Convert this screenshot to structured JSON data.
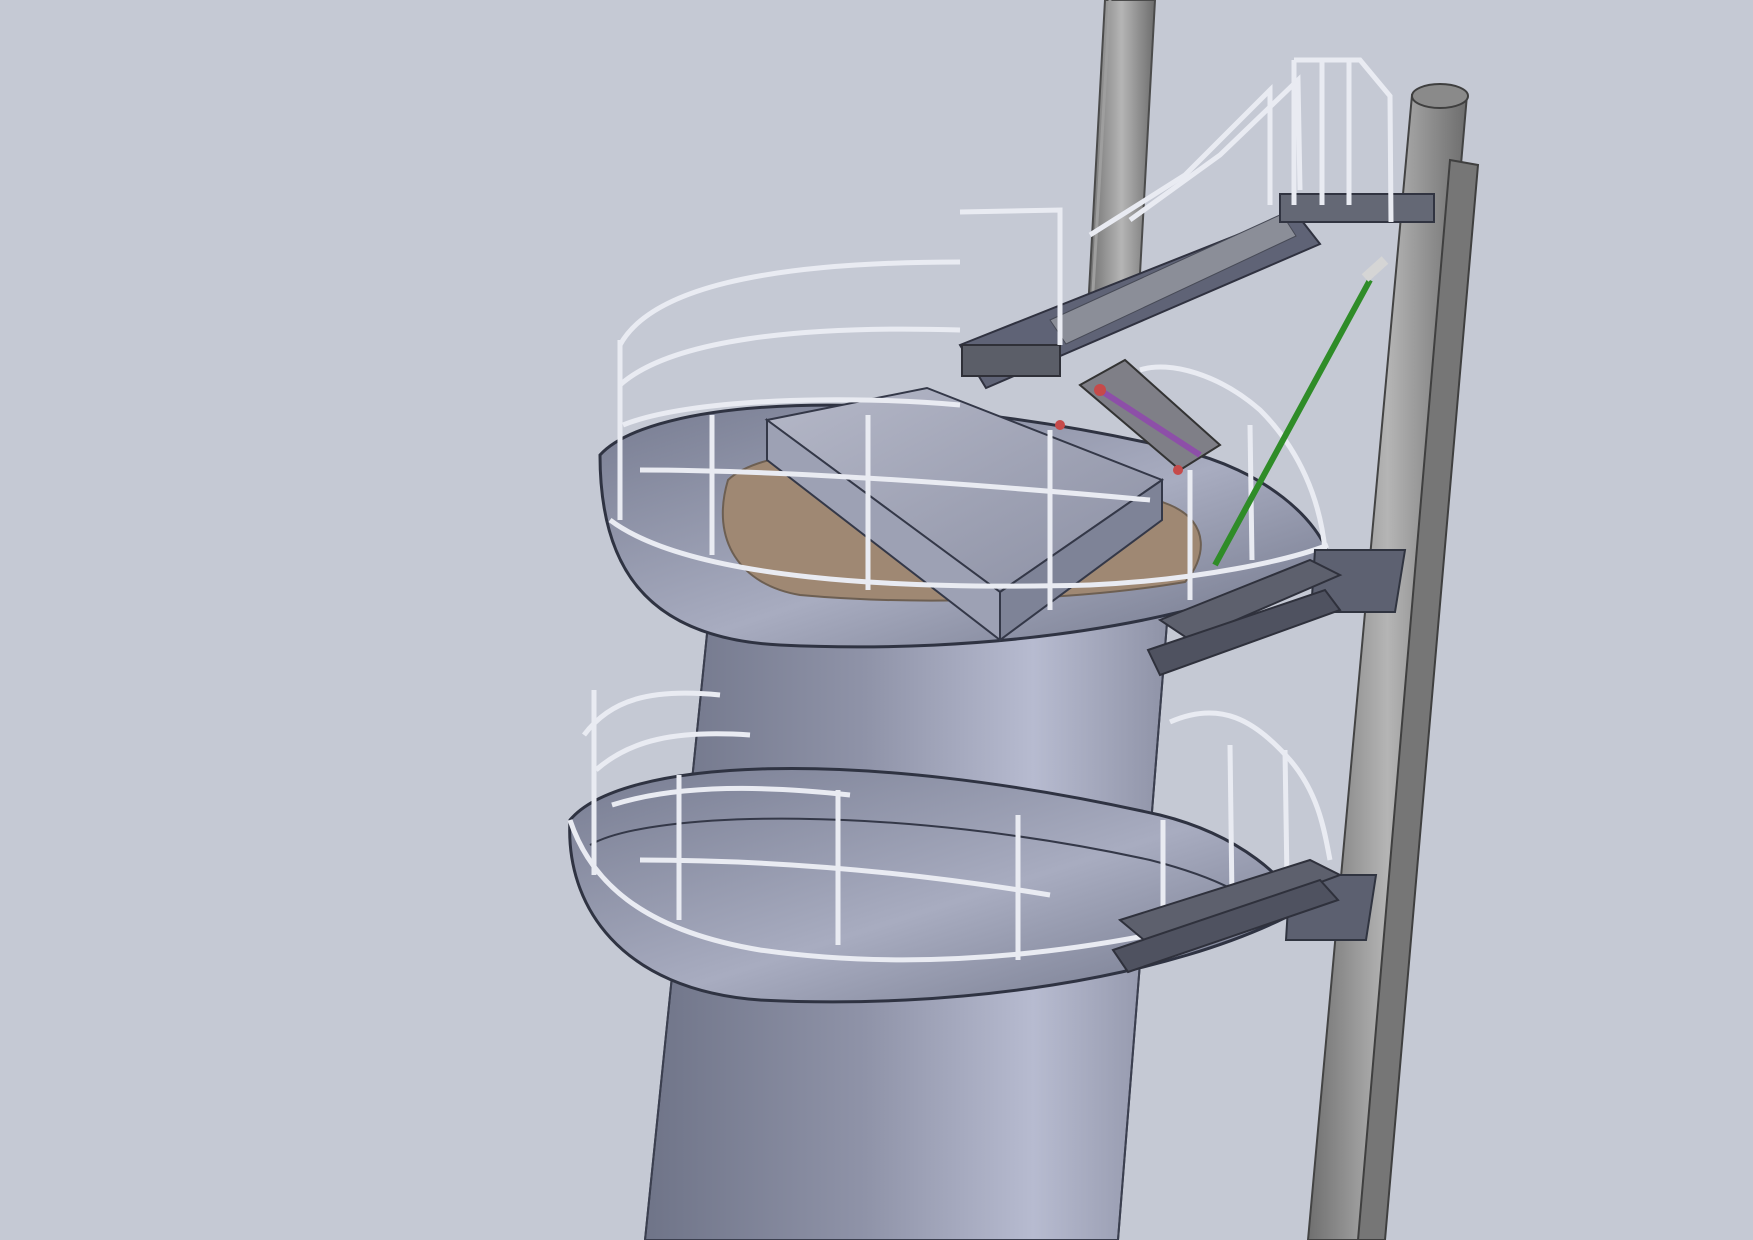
{
  "viewport": {
    "background_color": "#c5c9d4",
    "model_colors": {
      "steel_light": "#aeb2c6",
      "steel_dark": "#6f7488",
      "mast_gray": "#8f8f8f",
      "rail_white": "#e8eaf1",
      "deck_wood": "#9f8873",
      "green_cable": "#2f8c28",
      "purple_link": "#8d4fa8"
    }
  }
}
